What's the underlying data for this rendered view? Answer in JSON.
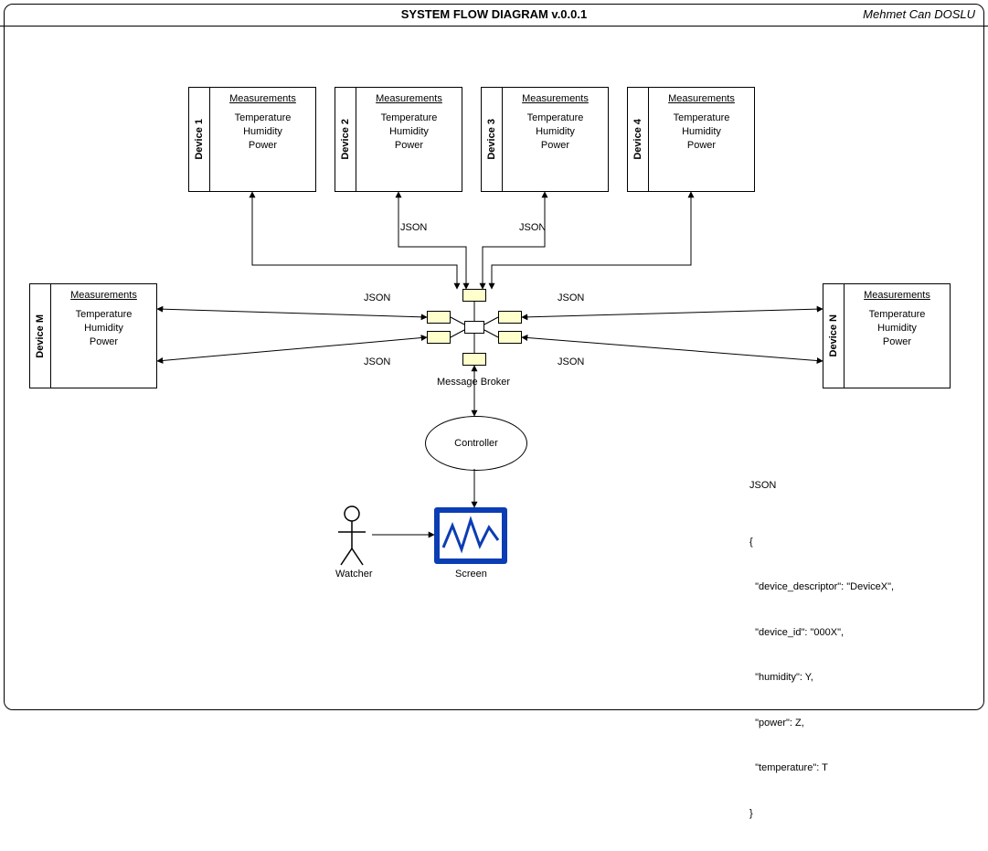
{
  "title": "SYSTEM FLOW DIAGRAM  v.0.0.1",
  "author": "Mehmet Can DOSLU",
  "device_measure_header": "Measurements",
  "measure_items": [
    "Temperature",
    "Humidity",
    "Power"
  ],
  "devices_top": [
    {
      "name": "Device 1"
    },
    {
      "name": "Device 2"
    },
    {
      "name": "Device 3"
    },
    {
      "name": "Device 4"
    }
  ],
  "device_left": {
    "name": "Device M"
  },
  "device_right": {
    "name": "Device N"
  },
  "flow_label": "JSON",
  "broker_label": "Message Broker",
  "controller_label": "Controller",
  "screen_label": "Screen",
  "watcher_label": "Watcher",
  "json_example": {
    "heading": "JSON",
    "lines": [
      "{",
      "  \"device_descriptor\": \"DeviceX\",",
      "  \"device_id\": \"000X\",",
      "  \"humidity\": Y,",
      "  \"power\": Z,",
      "  \"temperature\": T",
      "}"
    ]
  },
  "colors": {
    "port_fill": "#ffffcc",
    "screen_border": "#0b3db4"
  }
}
